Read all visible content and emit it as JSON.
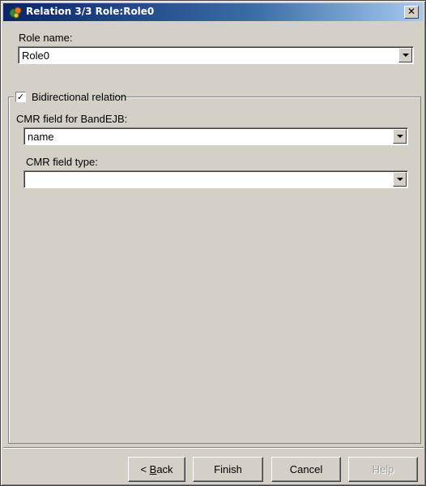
{
  "window": {
    "title": "Relation 3/3 Role:Role0",
    "close_glyph": "✕"
  },
  "role": {
    "label": "Role name:",
    "value": "Role0"
  },
  "bidirectional": {
    "label": "Bidirectional relation",
    "checked": true,
    "check_glyph": "✓"
  },
  "cmr_field": {
    "label": "CMR field for BandEJB:",
    "value": "name"
  },
  "cmr_type": {
    "label": "CMR field type:",
    "value": ""
  },
  "buttons": {
    "back_prefix": "< ",
    "back_mnemonic": "B",
    "back_rest": "ack",
    "finish": "Finish",
    "cancel": "Cancel",
    "help": "Help"
  },
  "colors": {
    "title_gradient_start": "#0a246a",
    "title_gradient_end": "#a6caf0",
    "face": "#d4d0c8"
  }
}
